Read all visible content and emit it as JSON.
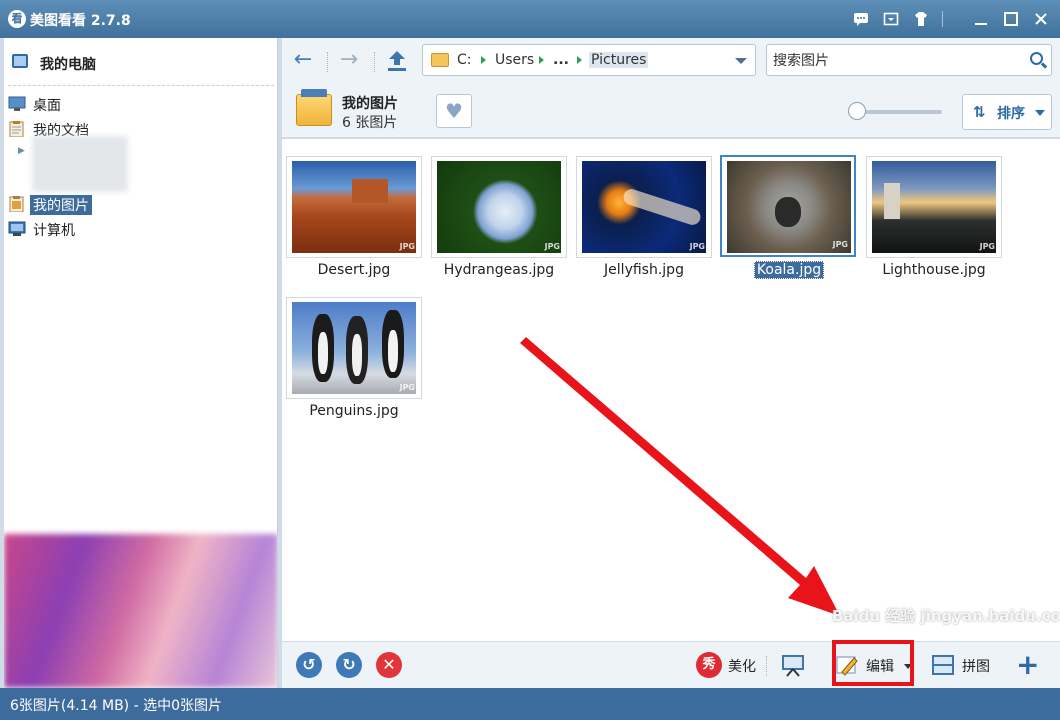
{
  "app": {
    "title": "美图看看 2.7.8",
    "logo_char": "看"
  },
  "titlebar": {
    "icons": [
      "feedback-icon",
      "menu-icon",
      "skin-icon",
      "minimize-icon",
      "maximize-icon",
      "close-icon"
    ]
  },
  "sidebar": {
    "header": "我的电脑",
    "items": [
      {
        "label": "桌面",
        "icon": "desktop-icon",
        "selected": false
      },
      {
        "label": "我的文档",
        "icon": "documents-icon",
        "selected": false
      },
      {
        "label": "我的图片",
        "icon": "pictures-icon",
        "selected": true
      },
      {
        "label": "计算机",
        "icon": "computer-icon",
        "selected": false
      }
    ]
  },
  "address": {
    "crumbs": [
      "C:",
      "Users",
      "...",
      "Pictures"
    ]
  },
  "search": {
    "value": "搜索图片",
    "placeholder": "搜索图片"
  },
  "folder": {
    "title": "我的图片",
    "count": "6 张图片"
  },
  "sort": {
    "label": "排序"
  },
  "images": [
    {
      "name": "Desert.jpg",
      "selected": false
    },
    {
      "name": "Hydrangeas.jpg",
      "selected": false
    },
    {
      "name": "Jellyfish.jpg",
      "selected": false
    },
    {
      "name": "Koala.jpg",
      "selected": true
    },
    {
      "name": "Lighthouse.jpg",
      "selected": false
    },
    {
      "name": "Penguins.jpg",
      "selected": false
    }
  ],
  "jpg_tag": "JPG",
  "bottom": {
    "beautify": "美化",
    "beautify_icon_char": "秀",
    "edit": "编辑",
    "puzzle": "拼图"
  },
  "status": {
    "text": "6张图片(4.14 MB) - 选中0张图片"
  },
  "watermark": {
    "text": "Baidu 经验 jingyan.baidu.com"
  },
  "colors": {
    "accent": "#3d6b9c",
    "annotation_red": "#e8141a"
  }
}
